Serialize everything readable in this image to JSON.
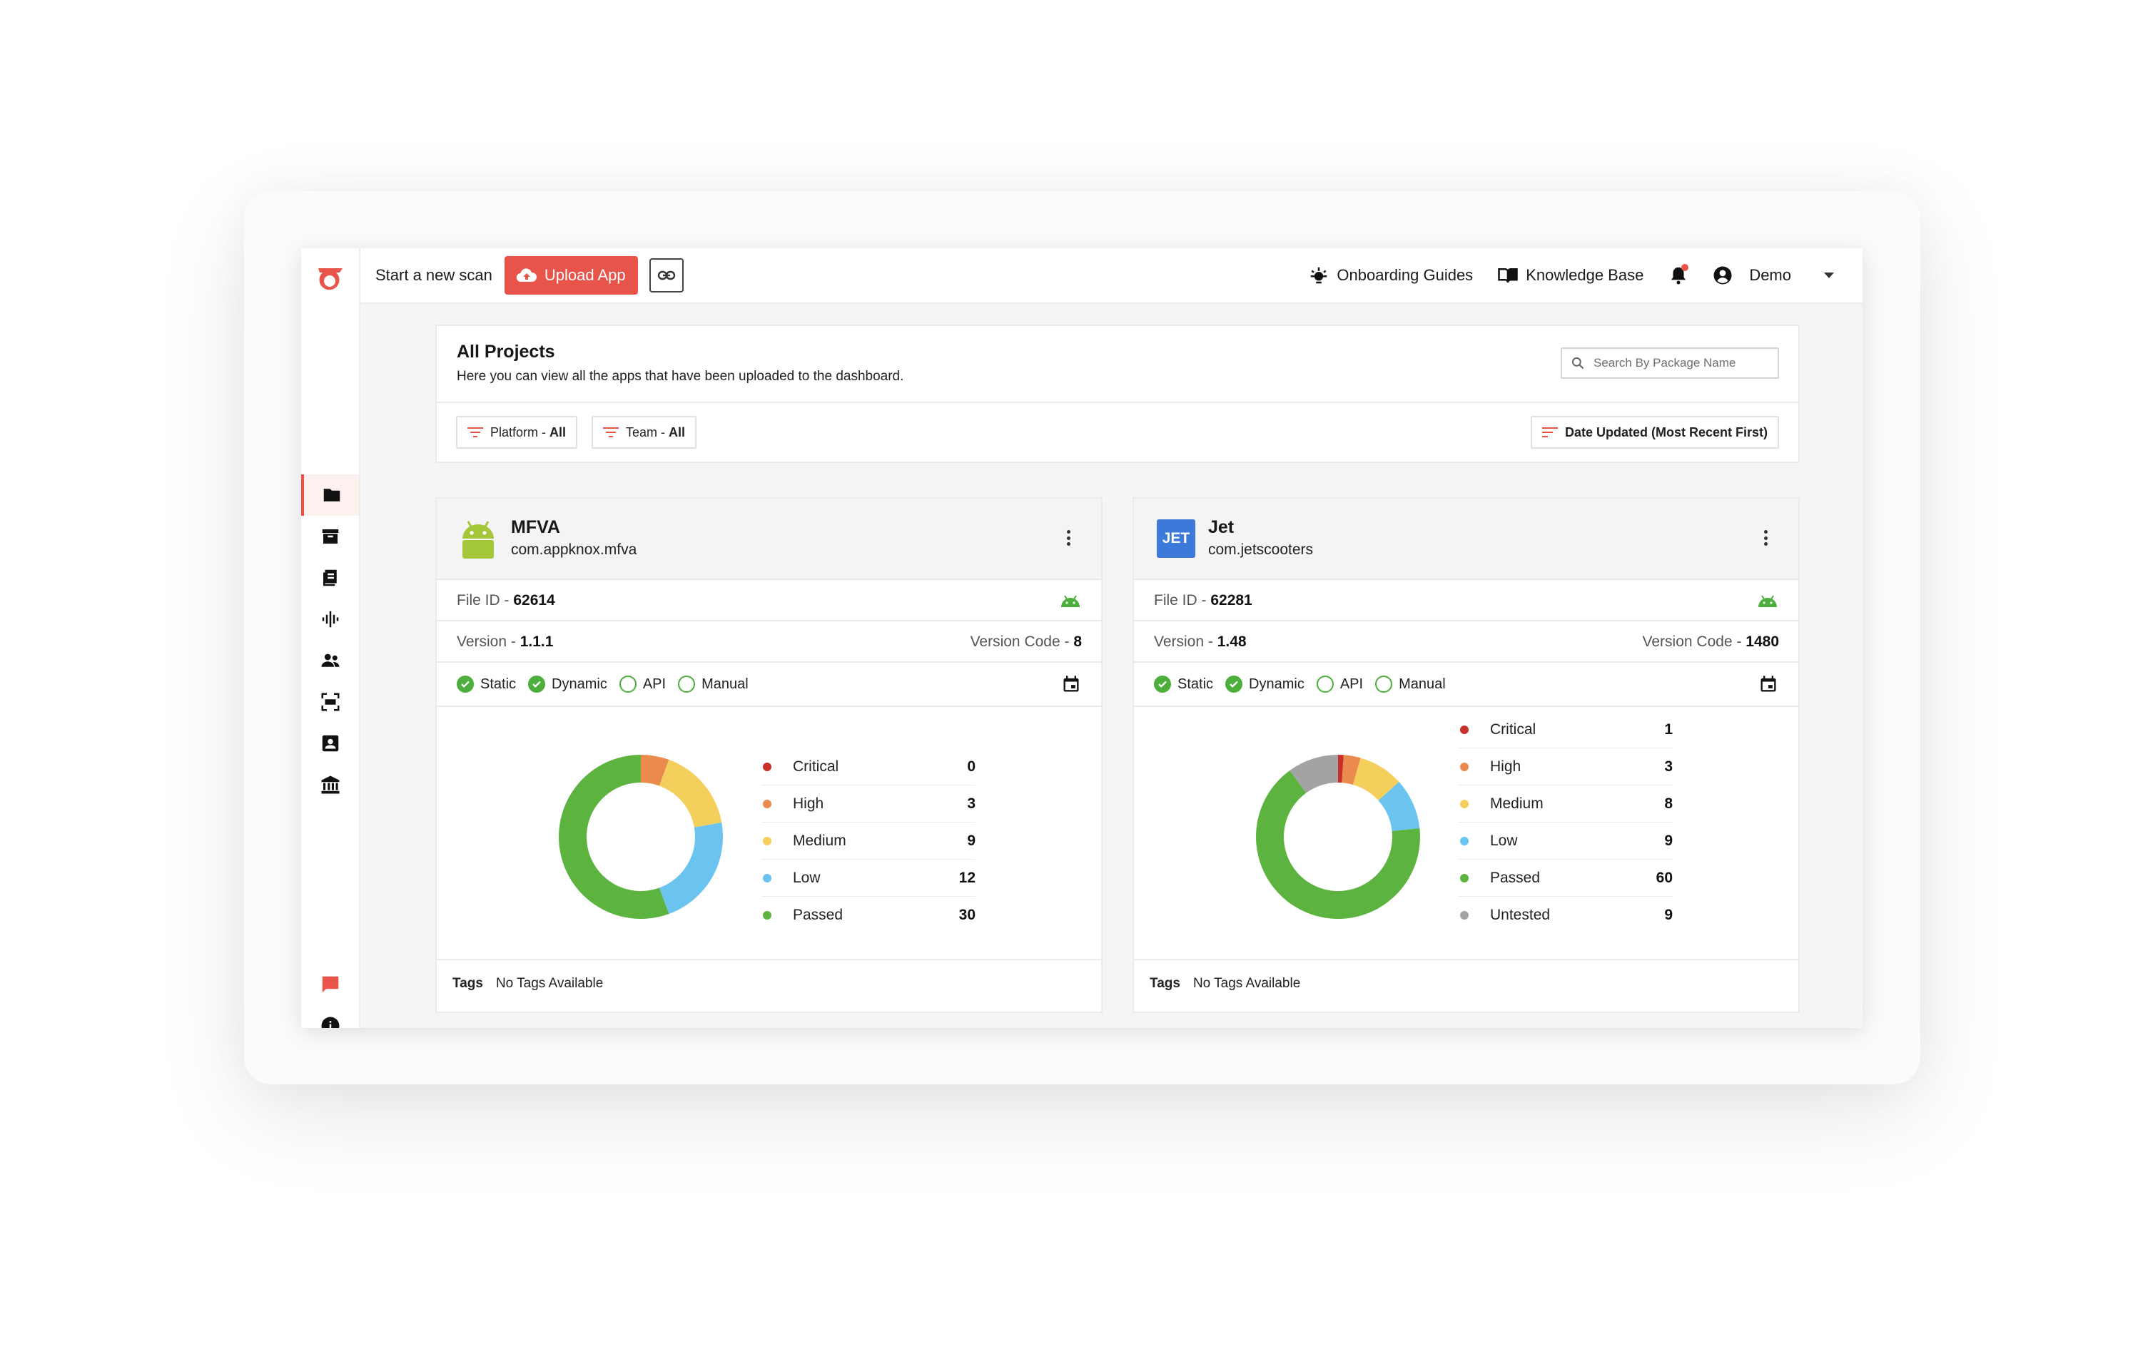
{
  "topbar": {
    "start_scan": "Start a new scan",
    "upload_label": "Upload App",
    "onboarding": "Onboarding Guides",
    "knowledge_base": "Knowledge Base",
    "user": "Demo"
  },
  "sidebar": {
    "items": [
      {
        "icon": "folder-icon",
        "active": true
      },
      {
        "icon": "archive-icon"
      },
      {
        "icon": "reports-icon"
      },
      {
        "icon": "audio-wave-icon"
      },
      {
        "icon": "people-icon"
      },
      {
        "icon": "api-scan-icon"
      },
      {
        "icon": "contact-card-icon"
      },
      {
        "icon": "bank-icon"
      },
      {
        "icon": "chat-icon"
      },
      {
        "icon": "info-icon"
      }
    ]
  },
  "projects": {
    "title": "All Projects",
    "subtitle": "Here you can view all the apps that have been uploaded to the dashboard.",
    "search_placeholder": "Search By Package Name",
    "filters": {
      "platform_label": "Platform - ",
      "platform_value": "All",
      "team_label": "Team - ",
      "team_value": "All",
      "sort_label": "Date Updated (Most Recent First)"
    }
  },
  "colors": {
    "accent": "#e8534a",
    "critical": "#c9302c",
    "high": "#ea8b4d",
    "medium": "#f5cf5b",
    "low": "#6bc4f0",
    "passed": "#5db33f",
    "untested": "#a3a3a3"
  },
  "cards": [
    {
      "name": "MFVA",
      "package": "com.appknox.mfva",
      "icon": "android-logo-icon",
      "file_id_label": "File ID - ",
      "file_id": "62614",
      "version_label": "Version - ",
      "version": "1.1.1",
      "version_code_label": "Version Code - ",
      "version_code": "8",
      "scans": [
        {
          "label": "Static",
          "done": true
        },
        {
          "label": "Dynamic",
          "done": true
        },
        {
          "label": "API",
          "done": false
        },
        {
          "label": "Manual",
          "done": false
        }
      ],
      "tags_label": "Tags",
      "tags_value": "No Tags Available",
      "chart_data": {
        "type": "pie",
        "labels": [
          "Critical",
          "High",
          "Medium",
          "Low",
          "Passed"
        ],
        "values": [
          0,
          3,
          9,
          12,
          30
        ],
        "color_keys": [
          "critical",
          "high",
          "medium",
          "low",
          "passed"
        ]
      }
    },
    {
      "name": "Jet",
      "package": "com.jetscooters",
      "icon": "jet-logo-icon",
      "icon_text": "JET",
      "file_id_label": "File ID - ",
      "file_id": "62281",
      "version_label": "Version - ",
      "version": "1.48",
      "version_code_label": "Version Code - ",
      "version_code": "1480",
      "scans": [
        {
          "label": "Static",
          "done": true
        },
        {
          "label": "Dynamic",
          "done": true
        },
        {
          "label": "API",
          "done": false
        },
        {
          "label": "Manual",
          "done": false
        }
      ],
      "tags_label": "Tags",
      "tags_value": "No Tags Available",
      "chart_data": {
        "type": "pie",
        "labels": [
          "Critical",
          "High",
          "Medium",
          "Low",
          "Passed",
          "Untested"
        ],
        "values": [
          1,
          3,
          8,
          9,
          60,
          9
        ],
        "color_keys": [
          "critical",
          "high",
          "medium",
          "low",
          "passed",
          "untested"
        ]
      }
    }
  ]
}
